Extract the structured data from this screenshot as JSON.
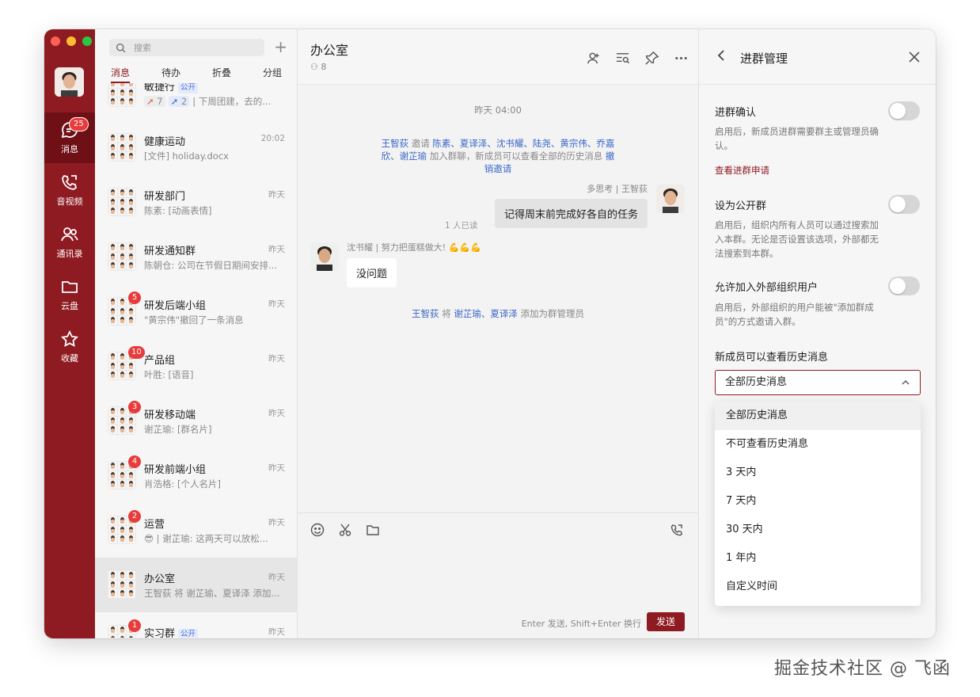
{
  "colors": {
    "brand": "#8e1b22",
    "badge": "#e83b3b",
    "link": "#3a66c9"
  },
  "rail": {
    "items": [
      {
        "label": "消息",
        "icon": "chat-icon",
        "badge": "25"
      },
      {
        "label": "音视频",
        "icon": "phone-icon"
      },
      {
        "label": "通讯录",
        "icon": "contacts-icon"
      },
      {
        "label": "云盘",
        "icon": "folder-icon"
      },
      {
        "label": "收藏",
        "icon": "star-icon"
      }
    ]
  },
  "list": {
    "search_placeholder": "搜索",
    "tabs": [
      "消息",
      "待办",
      "折叠",
      "分组"
    ],
    "partial": {
      "name": "敏捷行",
      "tag": "公开",
      "r1": "7",
      "r2": "2",
      "preview": "下周团建，去的..."
    },
    "conversations": [
      {
        "name": "健康运动",
        "time": "20:02",
        "preview": "[文件] holiday.docx"
      },
      {
        "name": "研发部门",
        "time": "昨天",
        "preview": "陈素: [动画表情]"
      },
      {
        "name": "研发通知群",
        "time": "昨天",
        "preview": "陈朝仓: 公司在节假日期间安排..."
      },
      {
        "name": "研发后端小组",
        "time": "昨天",
        "preview": "\"黄宗伟\"撤回了一条消息",
        "badge": "5"
      },
      {
        "name": "产品组",
        "time": "昨天",
        "preview": "叶胜: [语音]",
        "badge": "10"
      },
      {
        "name": "研发移动端",
        "time": "昨天",
        "preview": "谢芷瑜: [群名片]",
        "badge": "3"
      },
      {
        "name": "研发前端小组",
        "time": "昨天",
        "preview": "肖浩格: [个人名片]",
        "badge": "4"
      },
      {
        "name": "运营",
        "time": "昨天",
        "preview": "😎 | 谢芷瑜: 这两天可以放松...",
        "badge": "2"
      },
      {
        "name": "办公室",
        "time": "昨天",
        "preview": "王智荻 将 谢芷瑜、夏译泽 添加..."
      },
      {
        "name": "实习群",
        "time": "昨天",
        "preview": "",
        "badge": "1",
        "tag": "公开"
      }
    ]
  },
  "chat": {
    "title": "办公室",
    "members": "8",
    "timestamp": "昨天 04:00",
    "invite": {
      "inviter": "王智荻",
      "verb": "邀请",
      "invitees": "陈素、夏译泽、沈书耀、陆尧、黄宗伟、乔嘉欣、谢芷瑜",
      "suffix": "加入群聊，新成员可以查看全部的历史消息",
      "action": "撤销邀请"
    },
    "msg1": {
      "sender": "王智荻",
      "status": "多思考",
      "text": "记得周末前完成好各自的任务",
      "read": "1 人已读"
    },
    "msg2": {
      "sender": "沈书耀",
      "status": "努力把蛋糕做大!",
      "emoji": "💪💪💪",
      "text": "没问题"
    },
    "admin": {
      "actor": "王智荻",
      "verb": "将",
      "targets": "谢芷瑜、夏译泽",
      "suffix": "添加为群管理员"
    },
    "send_hint": "Enter 发送, Shift+Enter 换行",
    "send_label": "发送"
  },
  "panel": {
    "title": "进群管理",
    "s1": {
      "title": "进群确认",
      "desc": "启用后，新成员进群需要群主或管理员确认。",
      "link": "查看进群申请"
    },
    "s2": {
      "title": "设为公开群",
      "desc": "启用后，组织内所有人员可以通过搜索加入本群。无论是否设置该选项，外部都无法搜索到本群。"
    },
    "s3": {
      "title": "允许加入外部组织用户",
      "desc": "启用后，外部组织的用户能被\"添加群成员\"的方式邀请入群。"
    },
    "history": {
      "title": "新成员可以查看历史消息",
      "selected": "全部历史消息",
      "options": [
        "全部历史消息",
        "不可查看历史消息",
        "3 天内",
        "7 天内",
        "30 天内",
        "1 年内",
        "自定义时间"
      ]
    }
  },
  "footer": "掘金技术社区 @ 飞函"
}
